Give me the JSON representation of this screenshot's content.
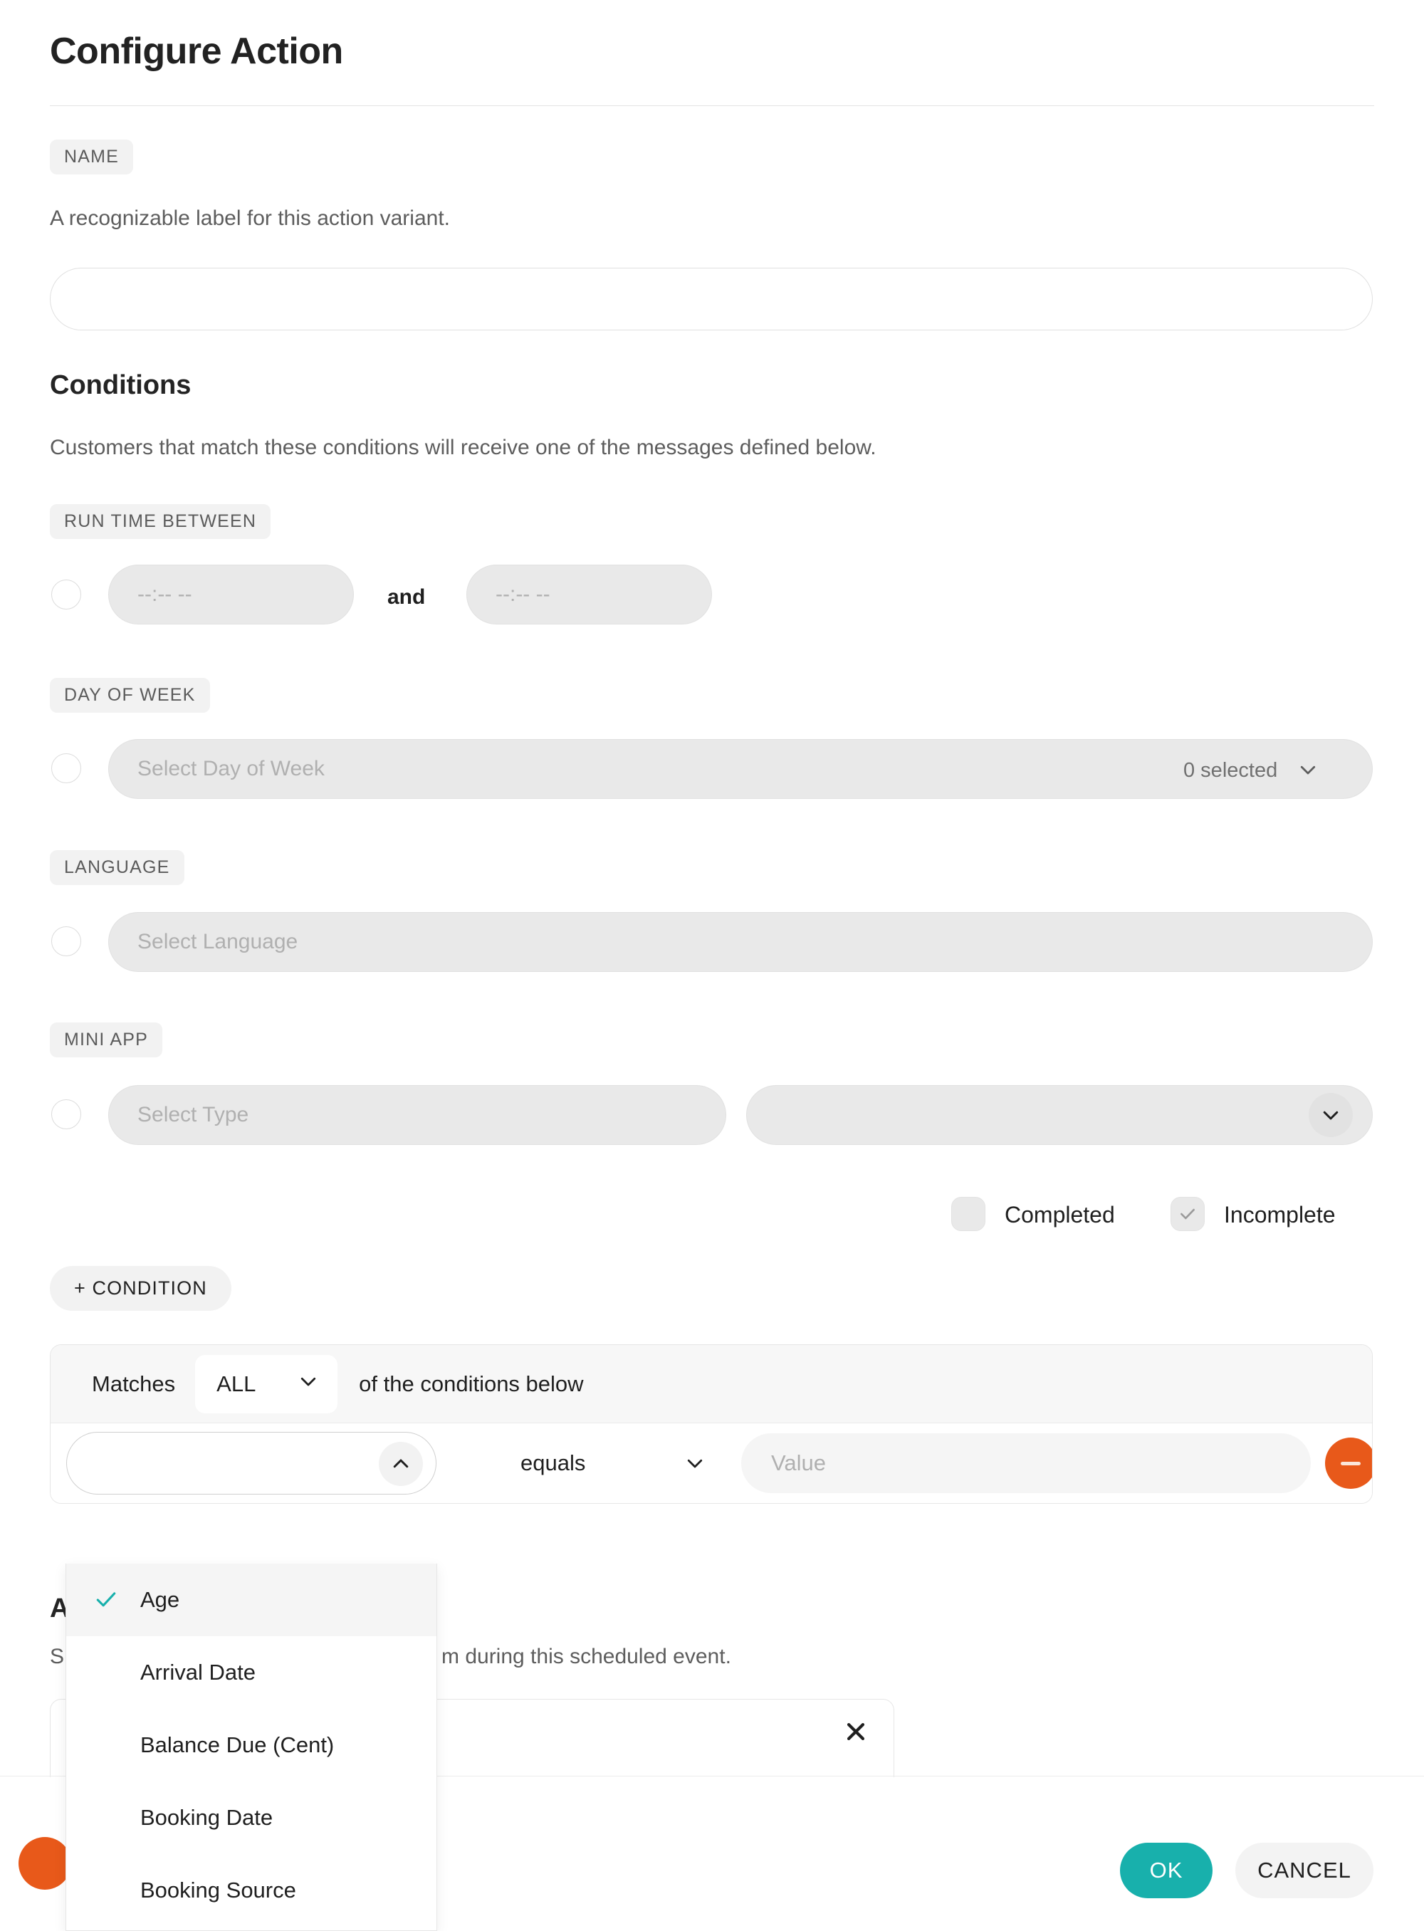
{
  "dialog": {
    "title": "Configure Action"
  },
  "name_section": {
    "chip_label": "NAME",
    "helper": "A recognizable label for this action variant.",
    "input_value": "",
    "input_placeholder": ""
  },
  "conditions_section": {
    "heading": "Conditions",
    "helper": "Customers that match these conditions will receive one of the messages defined below.",
    "run_time": {
      "chip_label": "RUN TIME BETWEEN",
      "start_placeholder": "--:-- --",
      "end_placeholder": "--:-- --",
      "and_label": "and",
      "radio_selected": false
    },
    "day_of_week": {
      "chip_label": "DAY OF WEEK",
      "placeholder": "Select Day of Week",
      "selected_count": "0 selected",
      "chevron_icon": "chevron-down-icon",
      "radio_selected": false
    },
    "language": {
      "chip_label": "LANGUAGE",
      "placeholder": "Select Language",
      "radio_selected": false
    },
    "mini_app": {
      "chip_label": "MINI APP",
      "type_placeholder": "Select Type",
      "second_placeholder": "",
      "chevron_icon": "chevron-down-icon",
      "radio_selected": false,
      "status_options": [
        {
          "label": "Completed",
          "checked": false
        },
        {
          "label": "Incomplete",
          "checked": true
        }
      ]
    },
    "add_condition_label": "+ CONDITION",
    "matcher": {
      "prefix": "Matches",
      "mode": "ALL",
      "suffix": "of the conditions below",
      "chevron_icon": "chevron-down-icon"
    },
    "condition_row": {
      "field_value": "",
      "field_caret_icon": "chevron-up-icon",
      "operator": "equals",
      "operator_caret_icon": "chevron-down-icon",
      "value_placeholder": "Value",
      "remove_icon": "minus-icon"
    },
    "field_dropdown": {
      "open": true,
      "check_icon": "check-icon",
      "items": [
        {
          "label": "Age",
          "selected": true
        },
        {
          "label": "Arrival Date",
          "selected": false
        },
        {
          "label": "Balance Due (Cent)",
          "selected": false
        },
        {
          "label": "Booking Date",
          "selected": false
        },
        {
          "label": "Booking Source",
          "selected": false
        }
      ]
    }
  },
  "actions_section": {
    "heading": "A",
    "helper_visible_start": "S",
    "helper_visible_end": "m during this scheduled event.",
    "message_card_close_icon": "close-icon"
  },
  "footer": {
    "ok_label": "OK",
    "cancel_label": "CANCEL"
  },
  "colors": {
    "accent_teal": "#18b0ac",
    "accent_orange": "#e8591a",
    "chip_bg": "#f2f2f2",
    "field_bg": "#e9e9e9"
  }
}
